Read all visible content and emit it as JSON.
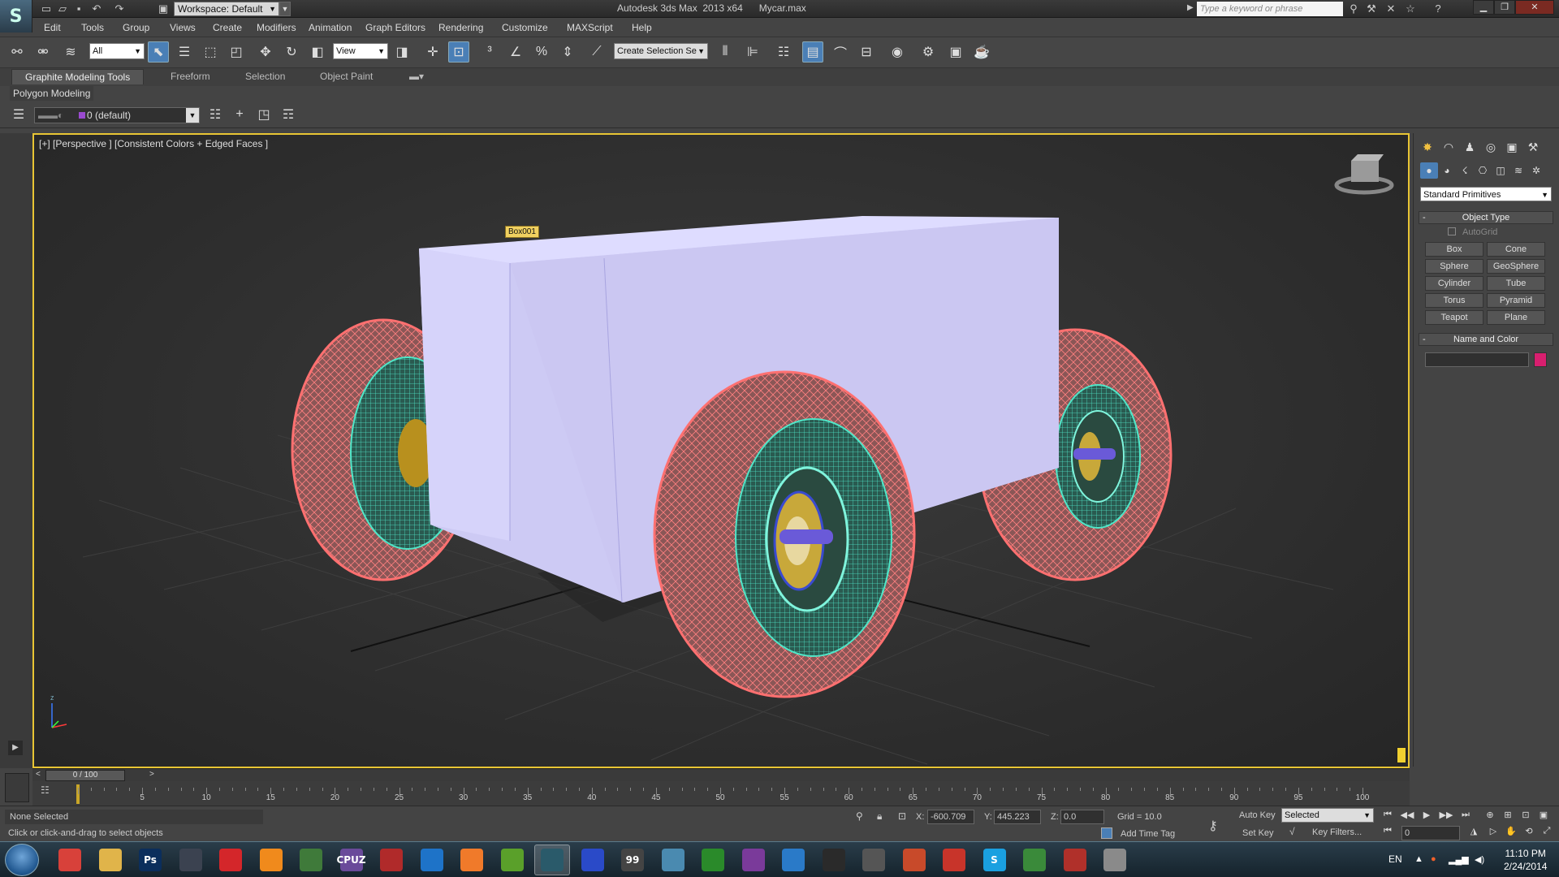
{
  "titlebar": {
    "workspace": "Workspace: Default",
    "app_title": "Autodesk 3ds Max  2013 x64",
    "file_name": "Mycar.max",
    "search_placeholder": "Type a keyword or phrase"
  },
  "menu": [
    "Edit",
    "Tools",
    "Group",
    "Views",
    "Create",
    "Modifiers",
    "Animation",
    "Graph Editors",
    "Rendering",
    "Customize",
    "MAXScript",
    "Help"
  ],
  "toolbar": {
    "selection_filter": "All",
    "ref_coord": "View",
    "named_selection": "Create Selection Se"
  },
  "ribbon": {
    "tabs": [
      "Graphite Modeling Tools",
      "Freeform",
      "Selection",
      "Object Paint"
    ],
    "panel": "Polygon Modeling"
  },
  "layer": {
    "current": "0 (default)"
  },
  "viewport": {
    "label": "[+] [Perspective ] [Consistent Colors + Edged Faces ]",
    "object_tooltip": "Box001",
    "colors": {
      "border": "#e8c534",
      "box": "#cdcaf4",
      "tire": "#8a5454",
      "mesh": "#3fd6b8",
      "wire": "#ff7a7a"
    }
  },
  "command_panel": {
    "category": "Standard Primitives",
    "object_type_title": "Object Type",
    "autogrid": "AutoGrid",
    "buttons": [
      "Box",
      "Cone",
      "Sphere",
      "GeoSphere",
      "Cylinder",
      "Tube",
      "Torus",
      "Pyramid",
      "Teapot",
      "Plane"
    ],
    "name_color_title": "Name and Color",
    "swatch_color": "#d81f6f"
  },
  "timeline": {
    "slider_label": "0 / 100",
    "ticks": [
      "5",
      "10",
      "15",
      "20",
      "25",
      "30",
      "35",
      "40",
      "45",
      "50",
      "55",
      "60",
      "65",
      "70",
      "75",
      "80",
      "85",
      "90",
      "95",
      "100"
    ]
  },
  "status": {
    "selection": "None Selected",
    "prompt": "Click or click-and-drag to select objects",
    "x_label": "X:",
    "x": "-600.709",
    "y_label": "Y:",
    "y": "445.223",
    "z_label": "Z:",
    "z": "0.0",
    "grid": "Grid = 10.0",
    "add_time_tag": "Add Time Tag",
    "auto_key": "Auto Key",
    "set_key": "Set Key",
    "key_mode": "Selected",
    "key_filters": "Key Filters...",
    "frame": "0"
  },
  "taskbar": {
    "lang": "EN",
    "time": "11:10 PM",
    "date": "2/24/2014",
    "apps": [
      {
        "name": "chrome",
        "label": "",
        "color": "#d8413a"
      },
      {
        "name": "explorer",
        "label": "",
        "color": "#e0b44a"
      },
      {
        "name": "photoshop",
        "label": "Ps",
        "color": "#0b2e5c"
      },
      {
        "name": "steam",
        "label": "",
        "color": "#3b4250"
      },
      {
        "name": "downloader",
        "label": "",
        "color": "#d4262a"
      },
      {
        "name": "vlc",
        "label": "",
        "color": "#f08a1c"
      },
      {
        "name": "spreadsheet",
        "label": "",
        "color": "#3f7a3a"
      },
      {
        "name": "cpuz",
        "label": "CPUZ",
        "color": "#6a4a9a"
      },
      {
        "name": "stripes",
        "label": "",
        "color": "#b02a2a"
      },
      {
        "name": "teamviewer",
        "label": "",
        "color": "#1e73c8"
      },
      {
        "name": "origin",
        "label": "",
        "color": "#f07a2a"
      },
      {
        "name": "utorrent",
        "label": "",
        "color": "#5aa02a"
      },
      {
        "name": "3dsmax",
        "label": "",
        "color": "#2a5a6a"
      },
      {
        "name": "globe",
        "label": "",
        "color": "#2a4ac8"
      },
      {
        "name": "99",
        "label": "99",
        "color": "#444"
      },
      {
        "name": "tool",
        "label": "",
        "color": "#4a8ab0"
      },
      {
        "name": "xbox",
        "label": "",
        "color": "#2a8a2a"
      },
      {
        "name": "gpu",
        "label": "",
        "color": "#7a3a9a"
      },
      {
        "name": "player",
        "label": "",
        "color": "#2a7ac8"
      },
      {
        "name": "clapper",
        "label": "",
        "color": "#2a2a2a"
      },
      {
        "name": "gamepad",
        "label": "",
        "color": "#555"
      },
      {
        "name": "bird",
        "label": "",
        "color": "#c84a2a"
      },
      {
        "name": "fruit",
        "label": "",
        "color": "#c8342a"
      },
      {
        "name": "skype",
        "label": "S",
        "color": "#1aa0e0"
      },
      {
        "name": "chart",
        "label": "",
        "color": "#3a8a3a"
      },
      {
        "name": "bird2",
        "label": "",
        "color": "#b0302a"
      },
      {
        "name": "chrome2",
        "label": "",
        "color": "#8a8a8a"
      }
    ]
  }
}
